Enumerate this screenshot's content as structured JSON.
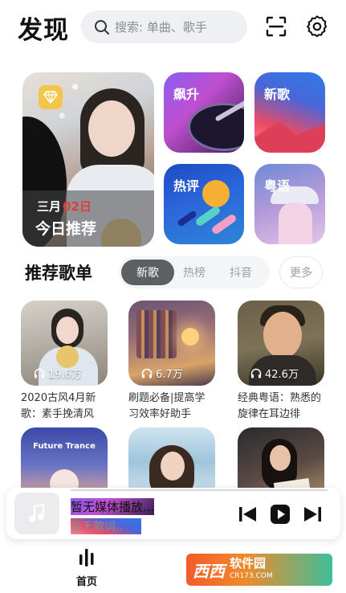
{
  "header": {
    "logo": "发现",
    "search_placeholder": "搜索: 单曲、歌手",
    "icons": [
      "search-icon",
      "scan-icon",
      "settings-gear-icon"
    ]
  },
  "featured": {
    "month": "三月",
    "day": "02日",
    "title": "今日推荐",
    "badge_icon": "diamond-icon"
  },
  "tiles": [
    {
      "label": "飙升"
    },
    {
      "label": "新歌"
    },
    {
      "label": "热评"
    },
    {
      "label": "粤语"
    }
  ],
  "section": {
    "title": "推荐歌单",
    "tabs": [
      {
        "label": "新歌",
        "active": true
      },
      {
        "label": "热榜",
        "active": false
      },
      {
        "label": "抖音",
        "active": false
      }
    ],
    "more": "更多"
  },
  "playlists": [
    {
      "count": "19.6万",
      "title": "2020古风4月新歌：素手挽清风"
    },
    {
      "count": "6.7万",
      "title": "刷题必备|提高学习效率好助手"
    },
    {
      "count": "42.6万",
      "title": "经典粤语：熟悉的旋律在耳边徘"
    },
    {
      "cover_text": "Future Trance",
      "count": "",
      "title": ""
    },
    {
      "count": "",
      "title": ""
    },
    {
      "count": "",
      "title": ""
    }
  ],
  "player": {
    "title": "暂无媒体播放...",
    "subtitle": "暂无歌词..",
    "controls": [
      "previous-icon",
      "play-icon",
      "next-icon"
    ]
  },
  "nav": {
    "home": "首页"
  },
  "watermark": {
    "brand": "西西",
    "name": "软件园",
    "url": "CR173.COM"
  },
  "colors": {
    "active_tab": "#5c5f64",
    "date_highlight": "#e23d3d",
    "search_bg": "#eef0f3"
  }
}
